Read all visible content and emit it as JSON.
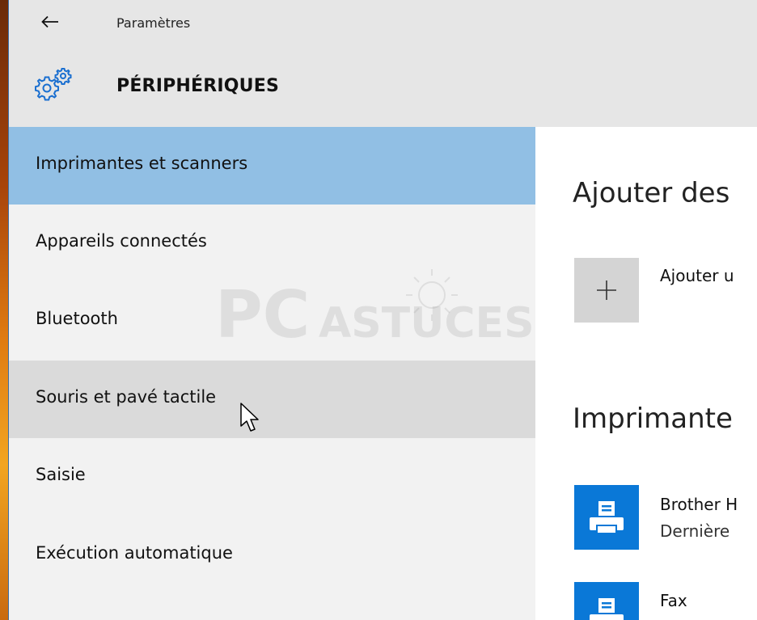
{
  "window": {
    "back_icon": "back-arrow-icon",
    "app_title": "Paramètres",
    "section_icon": "gear-icon",
    "section_title": "PÉRIPHÉRIQUES"
  },
  "sidebar": {
    "items": [
      {
        "label": "Imprimantes et scanners",
        "state": "selected"
      },
      {
        "label": "Appareils connectés",
        "state": "normal"
      },
      {
        "label": "Bluetooth",
        "state": "normal"
      },
      {
        "label": "Souris et pavé tactile",
        "state": "hover"
      },
      {
        "label": "Saisie",
        "state": "normal"
      },
      {
        "label": "Exécution automatique",
        "state": "normal"
      }
    ]
  },
  "content": {
    "add_heading": "Ajouter des",
    "add_button_icon": "plus-icon",
    "add_label": "Ajouter u",
    "printers_heading": "Imprimante",
    "printers": [
      {
        "name": "Brother H",
        "status": "Dernière ",
        "icon": "printer-icon"
      },
      {
        "name": "Fax",
        "status": "",
        "icon": "printer-icon"
      }
    ]
  },
  "watermark": {
    "text_pc": "PC",
    "text_astuces": "ASTUCES"
  },
  "colors": {
    "selected": "#91bfe4",
    "hover": "#dadada",
    "sidebar": "#f2f2f2",
    "header": "#e6e6e6",
    "accent": "#0a78d7",
    "gear": "#1a6fd0"
  }
}
